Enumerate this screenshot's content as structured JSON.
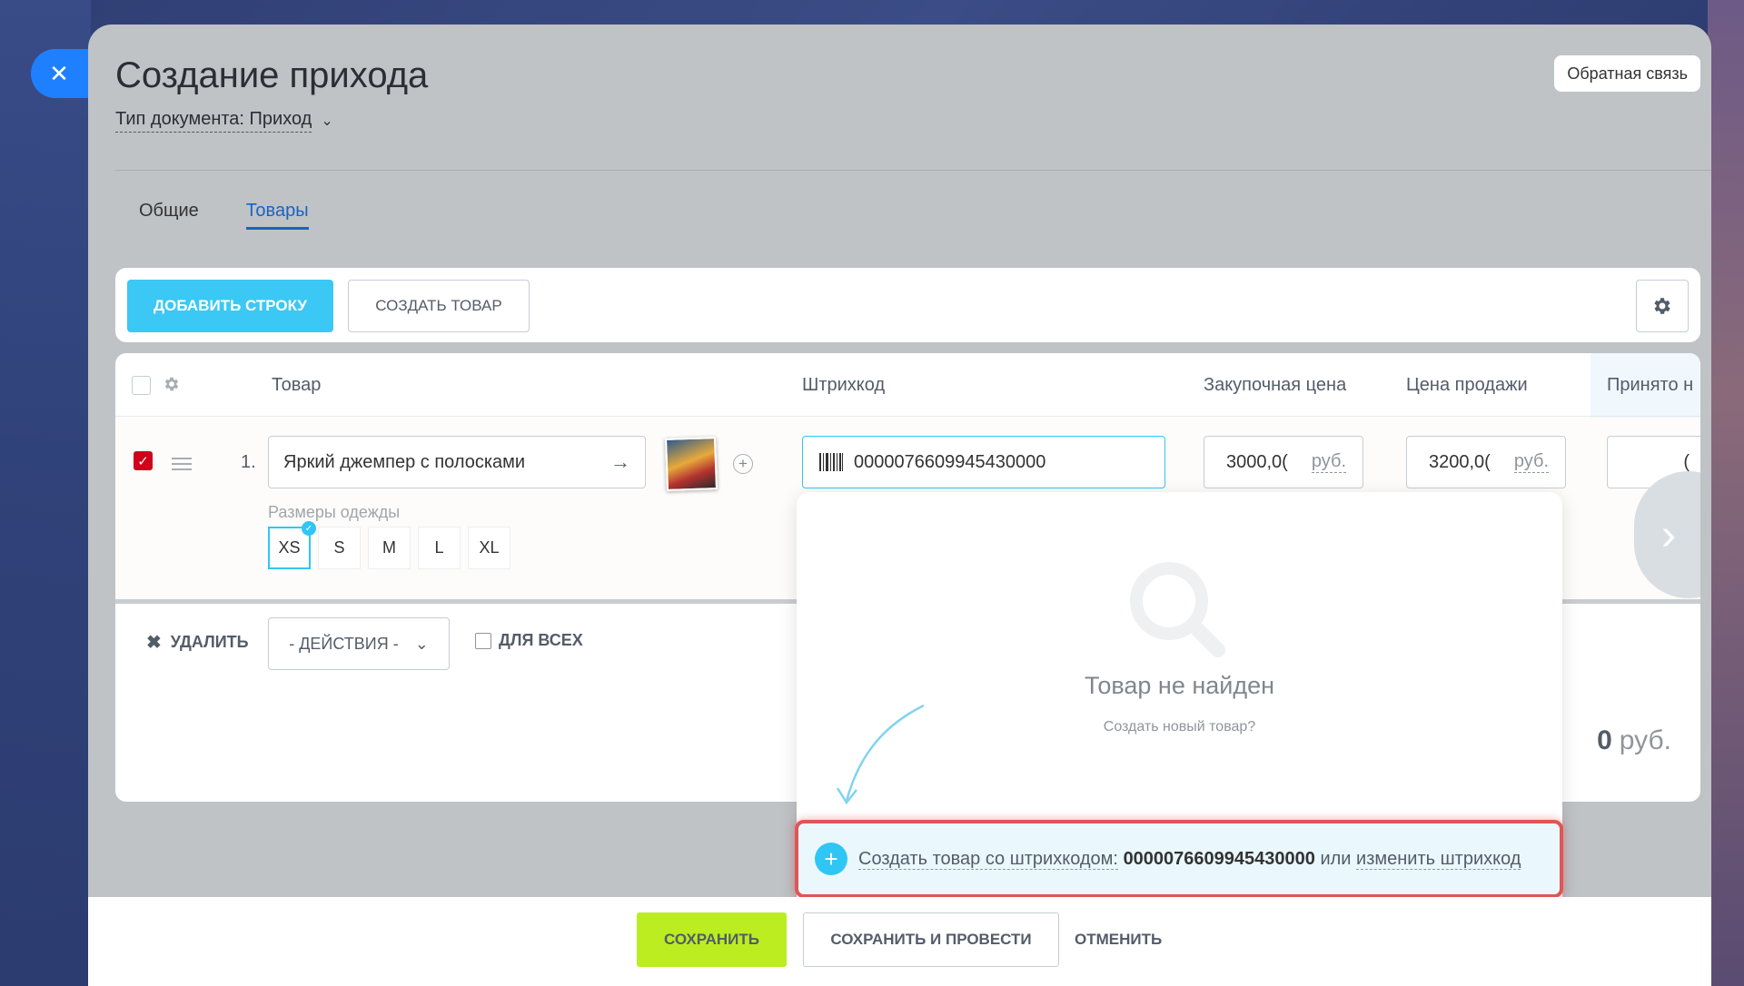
{
  "window": {
    "close_icon": "close-icon"
  },
  "header": {
    "title": "Создание прихода",
    "doc_type": "Тип документа: Приход",
    "feedback": "Обратная связь"
  },
  "tabs": [
    {
      "label": "Общие",
      "active": false
    },
    {
      "label": "Товары",
      "active": true
    }
  ],
  "toolbar": {
    "add_row": "ДОБАВИТЬ СТРОКУ",
    "create_product": "СОЗДАТЬ ТОВАР"
  },
  "grid": {
    "columns": {
      "product": "Товар",
      "barcode": "Штрихкод",
      "purchase_price": "Закупочная цена",
      "sale_price": "Цена продажи",
      "accepted": "Принято н"
    },
    "row": {
      "number": "1.",
      "name": "Яркий джемпер с полосками",
      "barcode": "0000076609945430000",
      "purchase_price": "3000,0(",
      "sale_price": "3200,0(",
      "currency": "руб.",
      "accepted_partial": "(",
      "sizes_label": "Размеры одежды",
      "sizes": [
        "XS",
        "S",
        "M",
        "L",
        "XL"
      ],
      "selected_size": "XS"
    },
    "actions": {
      "delete": "УДАЛИТЬ",
      "select": "- ДЕЙСТВИЯ -",
      "for_all": "ДЛЯ ВСЕХ"
    },
    "total_value": "0",
    "total_currency": "руб."
  },
  "popup": {
    "title": "Товар не найден",
    "subtitle": "Создать новый товар?",
    "create_prefix": "Создать товар со штрихкодом:",
    "create_code": "0000076609945430000",
    "or": "или",
    "change": "изменить штрихкод"
  },
  "footer": {
    "save": "СОХРАНИТЬ",
    "save_post": "СОХРАНИТЬ И ПРОВЕСТИ",
    "cancel": "ОТМЕНИТЬ"
  },
  "colors": {
    "accent": "#3bc8f5",
    "save": "#bbed21",
    "checkbox_checked": "#d0021b",
    "highlight": "#e05555",
    "link": "#1a63c2"
  }
}
